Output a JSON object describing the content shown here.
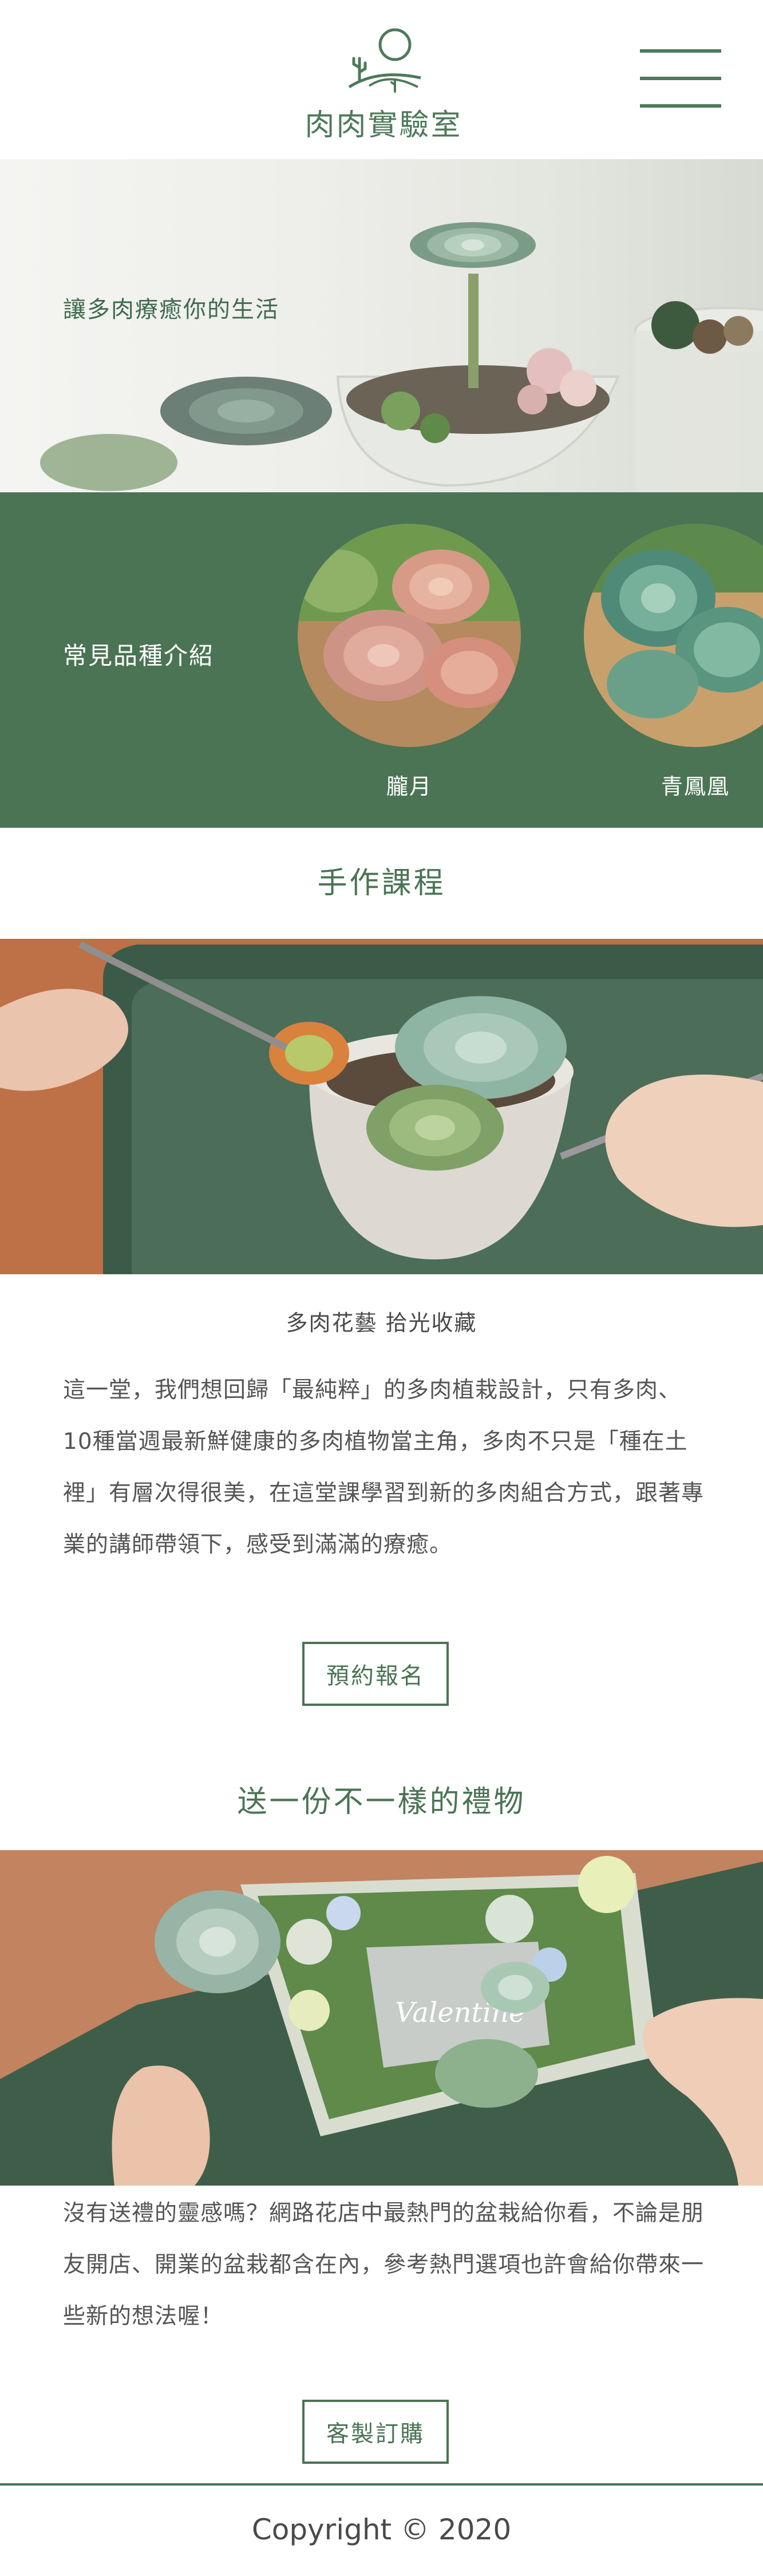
{
  "header": {
    "logo_text": "肉肉實驗室",
    "logo_icon": "succulent-sun-hill-icon",
    "menu_icon": "hamburger-menu-icon"
  },
  "hero": {
    "tagline": "讓多肉療癒你的生活"
  },
  "species": {
    "title": "常見品種介紹",
    "items": [
      {
        "name": "朧月"
      },
      {
        "name": "青鳳凰"
      }
    ]
  },
  "workshop": {
    "title": "手作課程",
    "subtitle": "多肉花藝 拾光收藏",
    "description": "這一堂，我們想回歸「最純粹」的多肉植栽設計，只有多肉、10種當週最新鮮健康的多肉植物當主角，多肉不只是「種在土裡」有層次得很美，在這堂課學習到新的多肉組合方式，跟著專業的講師帶領下，感受到滿滿的療癒。",
    "button_label": "預約報名"
  },
  "gift": {
    "title": "送一份不一樣的禮物",
    "description": "沒有送禮的靈感嗎？網路花店中最熱門的盆栽給你看，不論是朋友開店、開業的盆栽都含在內，參考熱門選項也許會給你帶來一些新的想法喔！",
    "button_label": "客製訂購",
    "card_text": "Valentine"
  },
  "footer": {
    "copyright": "Copyright © 2020"
  },
  "colors": {
    "brand_green": "#4a7454",
    "logo_green": "#4d7a5a"
  }
}
